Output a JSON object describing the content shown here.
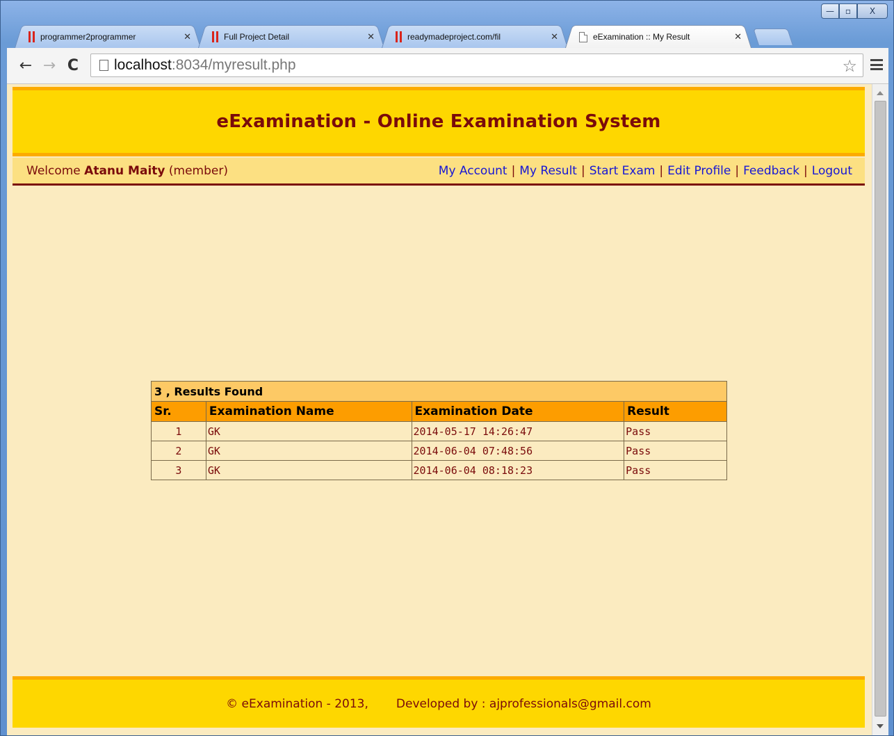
{
  "window": {
    "minimize_glyph": "—",
    "maximize_glyph": "▫",
    "close_glyph": "X"
  },
  "tabs": [
    {
      "title": "programmer2programmer",
      "favicon": "red-bars-icon",
      "active": false
    },
    {
      "title": "Full Project Detail",
      "favicon": "red-bars-icon",
      "active": false
    },
    {
      "title": "readymadeproject.com/fil",
      "favicon": "red-bars-icon",
      "active": false
    },
    {
      "title": "eExamination :: My Result",
      "favicon": "page-icon",
      "active": true
    }
  ],
  "toolbar": {
    "back": "←",
    "forward": "→",
    "reload": "C",
    "url_host": "localhost",
    "url_rest": ":8034/myresult.php",
    "star": "☆"
  },
  "site": {
    "title": "eExamination - Online Examination System",
    "welcome_prefix": "Welcome",
    "user_name": "Atanu Maity",
    "user_role": "(member)",
    "nav": [
      "My Account",
      "My Result",
      "Start Exam",
      "Edit Profile",
      "Feedback",
      "Logout"
    ],
    "separator": "|"
  },
  "results": {
    "caption": "3 , Results Found",
    "headers": [
      "Sr.",
      "Examination Name",
      "Examination Date",
      "Result"
    ],
    "rows": [
      {
        "sr": "1",
        "name": "GK",
        "date": "2014-05-17 14:26:47",
        "result": "Pass"
      },
      {
        "sr": "2",
        "name": "GK",
        "date": "2014-06-04 07:48:56",
        "result": "Pass"
      },
      {
        "sr": "3",
        "name": "GK",
        "date": "2014-06-04 08:18:23",
        "result": "Pass"
      }
    ]
  },
  "footer": {
    "copyright": "©  eExamination - 2013,",
    "developed": "Developed by : ajprofessionals@gmail.com"
  },
  "colors": {
    "header_bg": "#fed700",
    "accent_border": "#fcab00",
    "title_text": "#7a0b0b",
    "page_bg": "#fbebc0",
    "link": "#1717d4",
    "table_header": "#fd9d00"
  }
}
